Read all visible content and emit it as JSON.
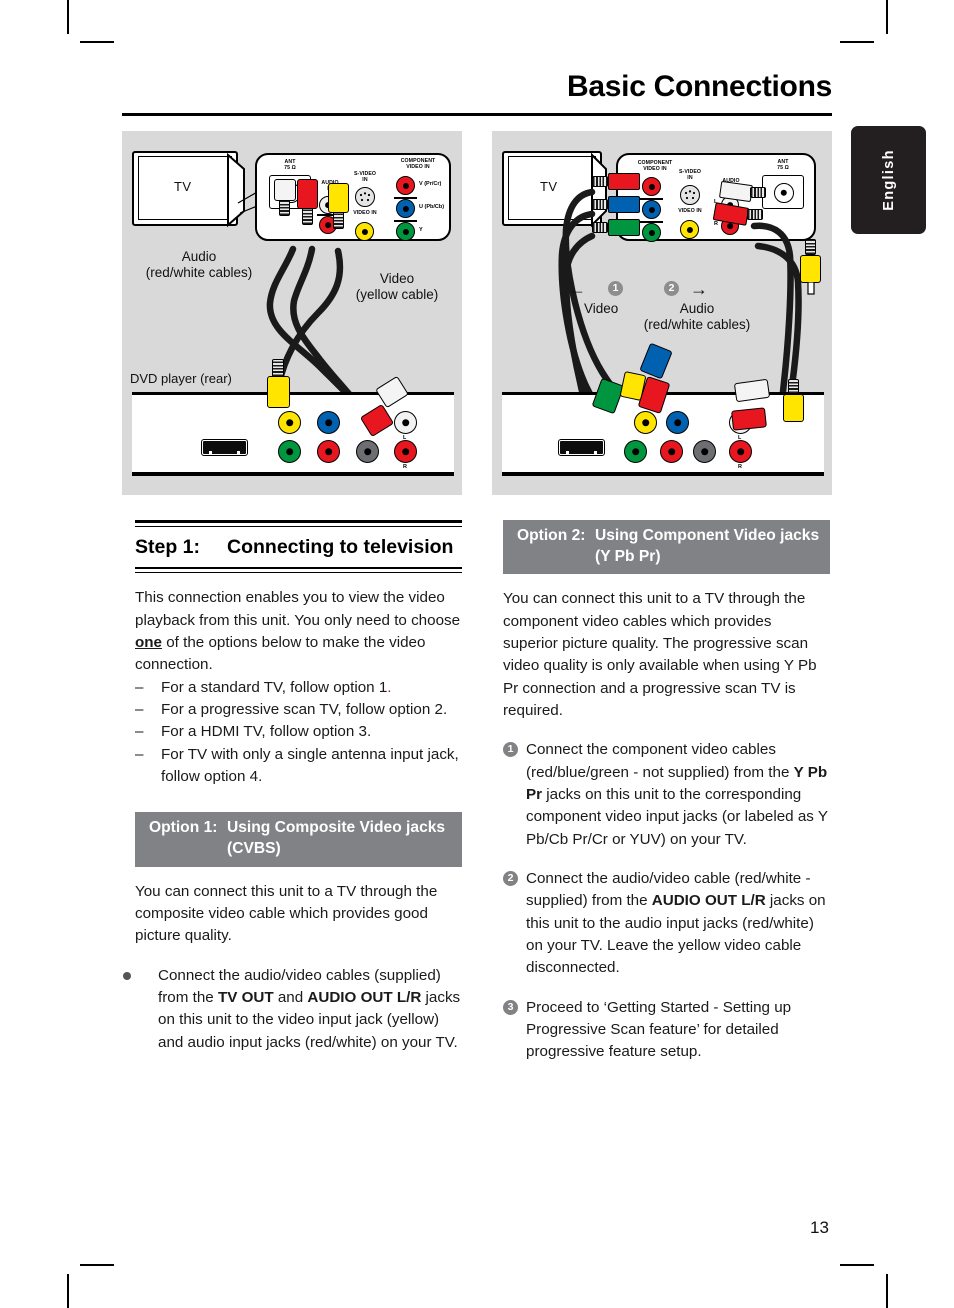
{
  "page": {
    "title": "Basic Connections",
    "language_tab": "English",
    "page_number": "13"
  },
  "diagram_left": {
    "name": "composite-connection-diagram",
    "tv_label": "TV",
    "device_label": "DVD player (rear)",
    "tv_panel": {
      "ant": "ANT\n75 Ω",
      "audio_in": "AUDIO\nIN",
      "audio_l": "L",
      "audio_r": "R",
      "s_video_in": "S-VIDEO\nIN",
      "video_in": "VIDEO IN",
      "component_video_in": "COMPONENT\nVIDEO IN",
      "comp_v": "V (Pr/Cr)",
      "comp_u": "U (Pb/Cb)",
      "comp_y": "Y"
    },
    "callouts": [
      {
        "text": "Audio\n(red/white cables)"
      },
      {
        "text": "Video\n(yellow cable)"
      }
    ],
    "dvd_jack_labels": {
      "l": "L",
      "r": "R"
    }
  },
  "diagram_right": {
    "name": "component-connection-diagram",
    "tv_label": "TV",
    "tv_panel": {
      "component_video_in": "COMPONENT\nVIDEO IN",
      "s_video_in": "S-VIDEO\nIN",
      "video_in": "VIDEO IN",
      "audio_in": "AUDIO\nIN",
      "audio_l": "L",
      "audio_r": "R",
      "ant": "ANT\n75 Ω"
    },
    "callouts": [
      {
        "number": "1",
        "text": "Video",
        "arrow": "←"
      },
      {
        "number": "2",
        "text": "Audio\n(red/white cables)",
        "arrow": "→"
      }
    ],
    "dvd_jack_labels": {
      "l": "L",
      "r": "R"
    }
  },
  "step": {
    "number": "Step 1:",
    "title": "Connecting to television",
    "intro_1": "This connection enables you to view the video playback from this unit. You only need to choose ",
    "intro_emph": "one",
    "intro_2": " of the options below to make the video connection.",
    "bullets": [
      {
        "dash": "–",
        "text": "For a standard TV, follow option 1",
        "tail": "."
      },
      {
        "dash": "–",
        "text": "For a progressive scan TV, follow option 2.",
        "tail": ""
      },
      {
        "dash": "–",
        "text": "For a HDMI TV, follow option 3.",
        "tail": ""
      },
      {
        "dash": "–",
        "text": "For TV with only a single antenna input jack, follow option 4.",
        "tail": ""
      }
    ]
  },
  "option1": {
    "bar_number": "Option 1:",
    "bar_title": "Using Composite Video jacks (CVBS)",
    "intro": "You can connect this unit to a TV through the composite video cable which provides good picture quality.",
    "item": {
      "pre": "Connect the audio/video cables (supplied) from the ",
      "b1": "TV OUT",
      "mid": " and ",
      "b2": "AUDIO OUT L/R",
      "post": " jacks on this unit to the video input jack (yellow) and audio input jacks (red/white) on your TV."
    }
  },
  "option2": {
    "bar_number": "Option 2:",
    "bar_title": "Using Component Video jacks (Y Pb Pr)",
    "intro": "You can connect this unit to a TV through the component video cables which provides superior picture quality. The progressive scan video quality is only available when using Y Pb Pr connection and a progressive scan TV is required.",
    "steps": [
      {
        "num": "1",
        "pre": "Connect the component video cables (red/blue/green - not supplied) from the ",
        "b1": "Y Pb Pr",
        "post": " jacks on this unit to the corresponding component video input jacks (or labeled as Y Pb/Cb Pr/Cr or YUV) on your TV."
      },
      {
        "num": "2",
        "pre": "Connect the audio/video cable (red/white - supplied) from the ",
        "b1": "AUDIO OUT L/R",
        "post": " jacks on this unit to the audio input jacks (red/white) on your TV. Leave the yellow video cable disconnected."
      },
      {
        "num": "3",
        "pre": "Proceed to ‘Getting Started - Setting up Progressive Scan feature’ for detailed progressive feature setup.",
        "b1": "",
        "post": ""
      }
    ]
  },
  "colors": {
    "option_bar": "#808285",
    "lang_tab": "#231f20",
    "diagram_bg": "#d9d9d9",
    "jack_red": "#e8171f",
    "jack_blue": "#0061b0",
    "jack_green": "#00963f",
    "jack_yellow": "#ffe500"
  }
}
